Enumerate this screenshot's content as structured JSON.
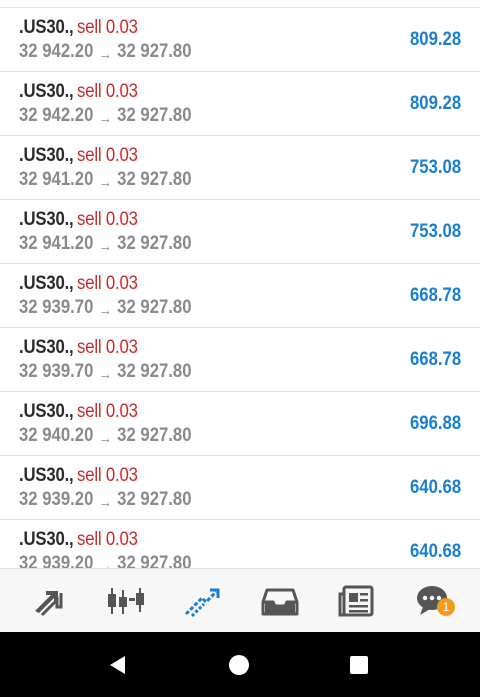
{
  "trades": [
    {
      "symbol": ".US30.,",
      "side": "sell 0.03",
      "open_price": "32 942.20",
      "arrow": "→",
      "current_price": "32 927.80",
      "profit": "809.28"
    },
    {
      "symbol": ".US30.,",
      "side": "sell 0.03",
      "open_price": "32 942.20",
      "arrow": "→",
      "current_price": "32 927.80",
      "profit": "809.28"
    },
    {
      "symbol": ".US30.,",
      "side": "sell 0.03",
      "open_price": "32 941.20",
      "arrow": "→",
      "current_price": "32 927.80",
      "profit": "753.08"
    },
    {
      "symbol": ".US30.,",
      "side": "sell 0.03",
      "open_price": "32 941.20",
      "arrow": "→",
      "current_price": "32 927.80",
      "profit": "753.08"
    },
    {
      "symbol": ".US30.,",
      "side": "sell 0.03",
      "open_price": "32 939.70",
      "arrow": "→",
      "current_price": "32 927.80",
      "profit": "668.78"
    },
    {
      "symbol": ".US30.,",
      "side": "sell 0.03",
      "open_price": "32 939.70",
      "arrow": "→",
      "current_price": "32 927.80",
      "profit": "668.78"
    },
    {
      "symbol": ".US30.,",
      "side": "sell 0.03",
      "open_price": "32 940.20",
      "arrow": "→",
      "current_price": "32 927.80",
      "profit": "696.88"
    },
    {
      "symbol": ".US30.,",
      "side": "sell 0.03",
      "open_price": "32 939.20",
      "arrow": "→",
      "current_price": "32 927.80",
      "profit": "640.68"
    },
    {
      "symbol": ".US30.,",
      "side": "sell 0.03",
      "open_price": "32 939.20",
      "arrow": "→",
      "current_price": "32 927.80",
      "profit": "640.68"
    }
  ],
  "tabbar": {
    "items": [
      {
        "icon": "quotes-arrows-icon",
        "active": false
      },
      {
        "icon": "chart-candles-icon",
        "active": false
      },
      {
        "icon": "trade-icon",
        "active": true
      },
      {
        "icon": "history-inbox-icon",
        "active": false
      },
      {
        "icon": "news-icon",
        "active": false
      },
      {
        "icon": "chat-icon",
        "active": false
      }
    ],
    "chat_badge": "1"
  },
  "colors": {
    "symbol": "#2b2b2b",
    "sell": "#cc2a2a",
    "price": "#8a8a8a",
    "profit": "#1a7fd0",
    "tab_icon": "#555555",
    "tab_active": "#1a7fd0",
    "badge": "#f39b1d"
  },
  "navigation": {
    "buttons": [
      "back-icon",
      "home-icon",
      "recents-icon"
    ]
  }
}
